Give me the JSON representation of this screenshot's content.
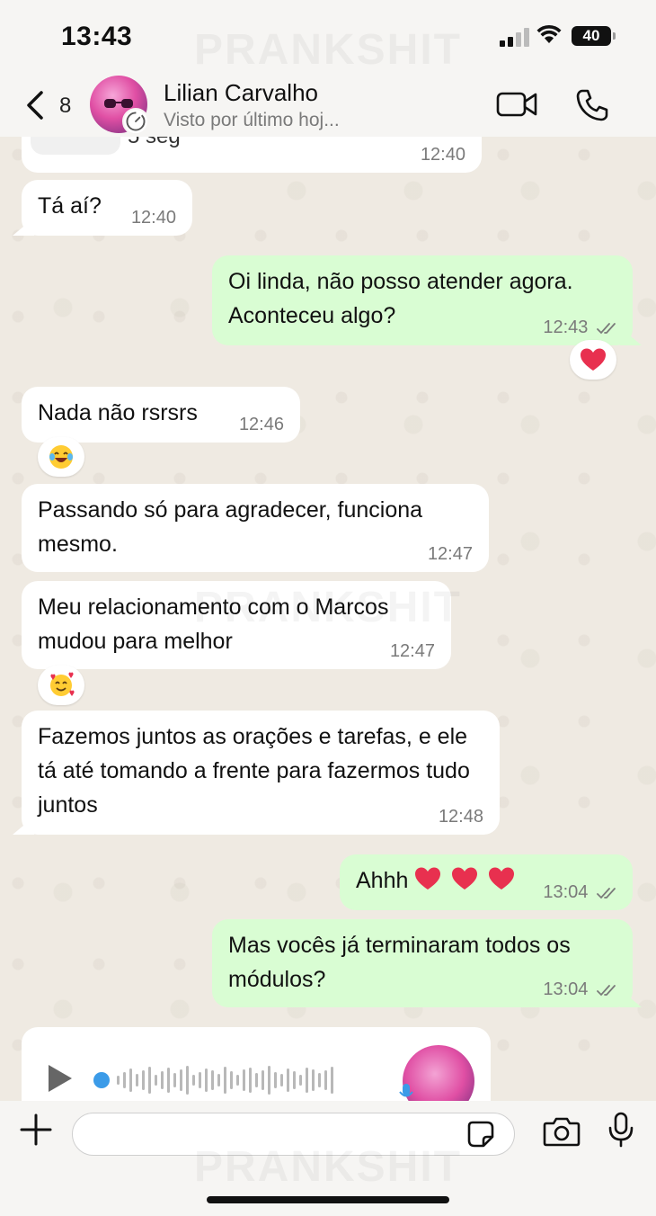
{
  "status_bar": {
    "time": "13:43",
    "battery": "40"
  },
  "header": {
    "back_count": "8",
    "contact_name": "Lilian Carvalho",
    "contact_status": "Visto por último hoj..."
  },
  "watermark": "PRANKSHIT",
  "top_card": {
    "partial_text": "5 seg",
    "time": "12:40"
  },
  "messages": [
    {
      "dir": "in",
      "text": "Tá aí?",
      "time": "12:40"
    },
    {
      "dir": "out",
      "text": "Oi linda, não posso atender agora. Aconteceu algo?",
      "time": "12:43",
      "read": true,
      "reaction": "red-heart"
    },
    {
      "dir": "in",
      "text": "Nada não rsrsrs",
      "time": "12:46",
      "reaction": "laughing-face"
    },
    {
      "dir": "in",
      "text": "Passando só para agradecer, funciona mesmo.",
      "time": "12:47"
    },
    {
      "dir": "in",
      "text": "Meu relacionamento com o Marcos mudou para melhor",
      "time": "12:47",
      "reaction": "smiling-face-with-hearts"
    },
    {
      "dir": "in",
      "text": "Fazemos juntos as orações e tarefas, e ele tá até tomando a frente para fazermos tudo juntos",
      "time": "12:48"
    },
    {
      "dir": "out",
      "text": "Ahhh",
      "time": "13:04",
      "read": true,
      "emoji": [
        "red-heart",
        "red-heart",
        "red-heart"
      ]
    },
    {
      "dir": "out",
      "text": "Mas vocês já terminaram todos os módulos?",
      "time": "13:04",
      "read": true
    }
  ],
  "voice_message": {
    "progress": 0
  },
  "input": {
    "placeholder": ""
  },
  "icons": {
    "back": "chevron-left-icon",
    "video": "video-camera-icon",
    "call": "phone-icon",
    "plus": "plus-icon",
    "sticker": "sticker-icon",
    "camera": "camera-icon",
    "mic": "microphone-icon"
  },
  "colors": {
    "incoming": "#ffffff",
    "outgoing": "#d9fdd3",
    "read_ticks": "#7a7a7a",
    "voice_progress": "#3b9be8"
  }
}
